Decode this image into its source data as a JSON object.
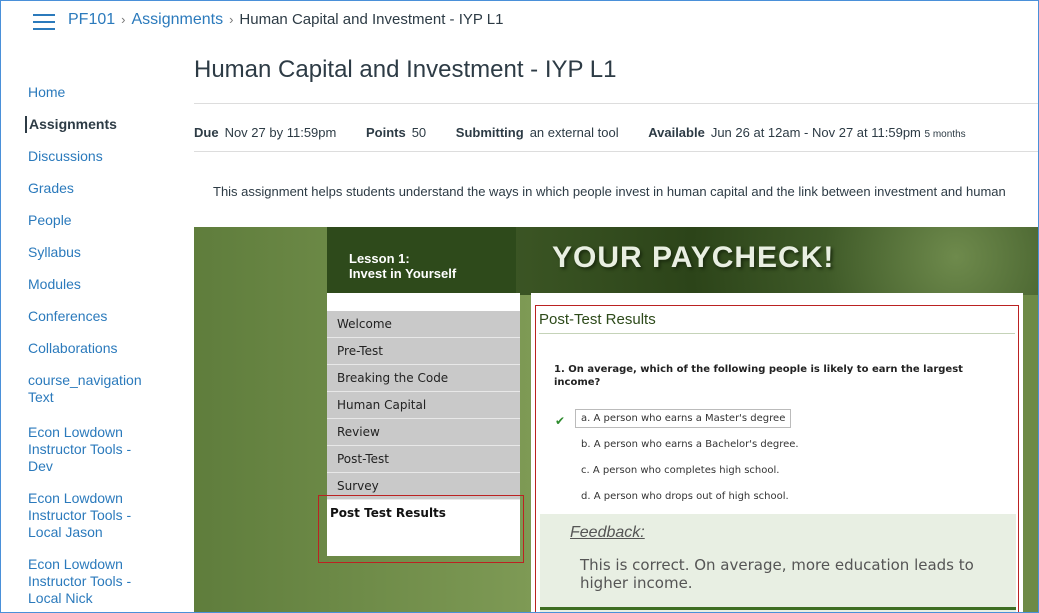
{
  "header": {
    "course": "PF101",
    "assignments": "Assignments",
    "separator": "›",
    "current": "Human Capital and Investment - IYP L1"
  },
  "nav": {
    "items": [
      "Home",
      "Assignments",
      "Discussions",
      "Grades",
      "People",
      "Syllabus",
      "Modules",
      "Conferences",
      "Collaborations",
      "course_navigation Text",
      "Econ Lowdown Instructor Tools - Dev",
      "Econ Lowdown Instructor Tools - Local Jason",
      "Econ Lowdown Instructor Tools - Local Nick"
    ],
    "active": "Assignments"
  },
  "assignment": {
    "title": "Human Capital and Investment - IYP L1",
    "due_label": "Due",
    "due": "Nov 27 by 11:59pm",
    "points_label": "Points",
    "points": "50",
    "submitting_label": "Submitting",
    "submitting": "an external tool",
    "available_label": "Available",
    "available": "Jun 26 at 12am - Nov 27 at 11:59pm",
    "available_duration": "5 months",
    "description": "This assignment helps students understand the ways in which people invest in human capital and the link between investment and human"
  },
  "tool": {
    "lesson_line1": "Lesson 1:",
    "lesson_line2": "Invest in Yourself",
    "banner": "YOUR PAYCHECK!",
    "menu": [
      "Welcome",
      "Pre-Test",
      "Breaking the Code",
      "Human Capital",
      "Review",
      "Post-Test",
      "Survey"
    ],
    "menu_active": "Post Test Results",
    "results_title": "Post-Test Results",
    "question": "1. On average, which of the following people is likely to earn the largest income?",
    "options": [
      "a. A person who earns a Master's degree",
      "b. A person who earns a Bachelor's degree.",
      "c. A person who completes high school.",
      "d. A person who drops out of high school."
    ],
    "selected_index": 0,
    "feedback_title": "Feedback:",
    "feedback_text": "This is correct. On average, more education leads to higher income."
  },
  "colors": {
    "link": "#2b7abc",
    "text": "#2d3b45",
    "highlight_border": "#b22222",
    "green_dark": "#2e4a1b"
  }
}
